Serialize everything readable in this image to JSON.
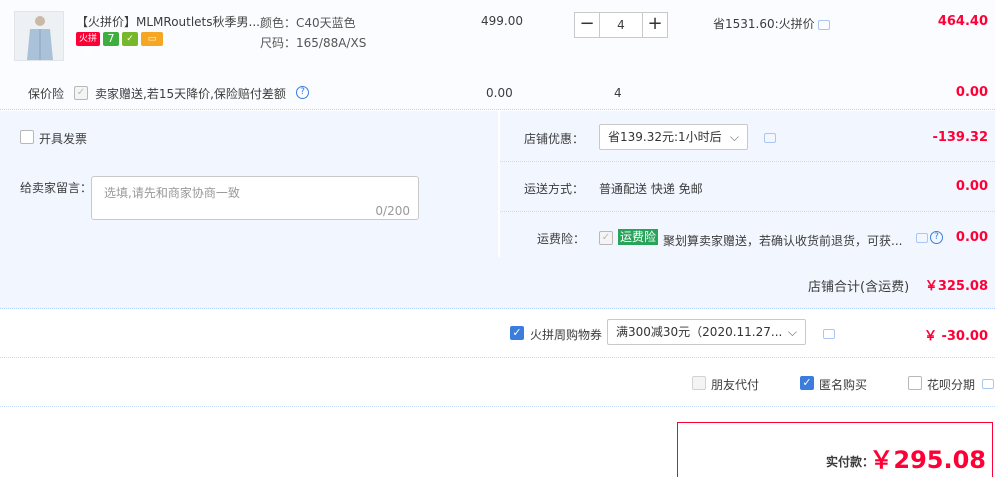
{
  "item": {
    "title": "【火拼价】MLMRoutlets秋季男...",
    "color_label": "颜色：C40天蓝色",
    "size_label": "尺码：165/88A/XS",
    "unit_price": "499.00",
    "quantity": "4",
    "qty_minus": "−",
    "qty_plus": "+",
    "discount_text": "省1531.60:火拼价",
    "subtotal": "464.40",
    "badges": [
      "火拼价",
      "7",
      "",
      ""
    ]
  },
  "insurance": {
    "label": "保价险",
    "desc": "卖家赠送,若15天降价,保险赔付差额",
    "price": "0.00",
    "qty": "4",
    "subtotal": "0.00"
  },
  "invoice": {
    "label": "开具发票"
  },
  "message": {
    "label": "给卖家留言：",
    "placeholder": "选填,请先和商家协商一致",
    "counter": "0/200"
  },
  "shop_discount": {
    "label": "店铺优惠：",
    "selected": "省139.32元:1小时后",
    "amount": "-139.32"
  },
  "shipping": {
    "label": "运送方式：",
    "value": "普通配送 快递 免邮",
    "amount": "0.00"
  },
  "shipping_insurance": {
    "label": "运费险：",
    "tag": "运费险",
    "desc": "聚划算卖家赠送，若确认收货前退货，可获...",
    "amount": "0.00"
  },
  "shop_total": {
    "label": "店铺合计(含运费)",
    "amount": "￥325.08"
  },
  "coupon": {
    "label": "火拼周购物券",
    "selected": "满300减30元（2020.11.27...",
    "amount": "￥ -30.00"
  },
  "pay_options": {
    "friend_pay": "朋友代付",
    "anonymous": "匿名购买",
    "huabei": "花呗分期"
  },
  "actual_pay": {
    "label": "实付款：",
    "amount": "￥295.08"
  },
  "colors": {
    "accent_red": "#ff0036",
    "checkbox_blue": "#3b7ddd",
    "light_blue_bg": "#f2f7ff",
    "tag_green": "#27a45a"
  }
}
